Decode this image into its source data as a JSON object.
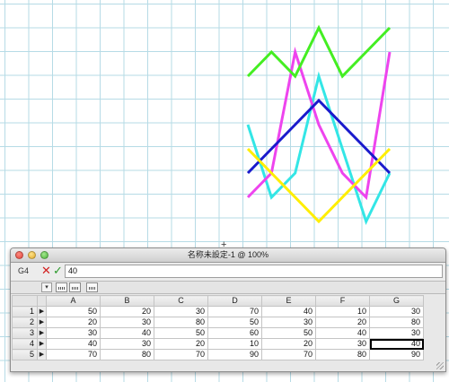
{
  "window": {
    "title": "名称未設定-1 @ 100%"
  },
  "formula_bar": {
    "cell_ref": "G4",
    "value": "40"
  },
  "sheet": {
    "columns": [
      "A",
      "B",
      "C",
      "D",
      "E",
      "F",
      "G"
    ],
    "row_numbers": [
      "1",
      "2",
      "3",
      "4",
      "5"
    ],
    "active_cell": {
      "row": 4,
      "column": "G"
    },
    "rows": [
      [
        "50",
        "20",
        "30",
        "70",
        "40",
        "10",
        "30"
      ],
      [
        "20",
        "30",
        "80",
        "50",
        "30",
        "20",
        "80"
      ],
      [
        "30",
        "40",
        "50",
        "60",
        "50",
        "40",
        "30"
      ],
      [
        "40",
        "30",
        "20",
        "10",
        "20",
        "30",
        "40"
      ],
      [
        "70",
        "80",
        "70",
        "90",
        "70",
        "80",
        "90"
      ]
    ]
  },
  "chart_data": {
    "type": "line",
    "categories": [
      "A",
      "B",
      "C",
      "D",
      "E",
      "F",
      "G"
    ],
    "series": [
      {
        "values": [
          50,
          20,
          30,
          70,
          40,
          10,
          30
        ],
        "color": "#33e6e6"
      },
      {
        "values": [
          20,
          30,
          80,
          50,
          30,
          20,
          80
        ],
        "color": "#ee44ee"
      },
      {
        "values": [
          30,
          40,
          50,
          60,
          50,
          40,
          30
        ],
        "color": "#1a1acc"
      },
      {
        "values": [
          40,
          30,
          20,
          10,
          20,
          30,
          40
        ],
        "color": "#ffee00"
      },
      {
        "values": [
          70,
          80,
          70,
          90,
          70,
          80,
          90
        ],
        "color": "#44ee22"
      }
    ],
    "ylim": [
      0,
      100
    ],
    "axes_visible": false,
    "legend": "none"
  },
  "icons": [
    "cancel-icon",
    "confirm-icon",
    "dropdown-icon",
    "toolbar-icon"
  ]
}
